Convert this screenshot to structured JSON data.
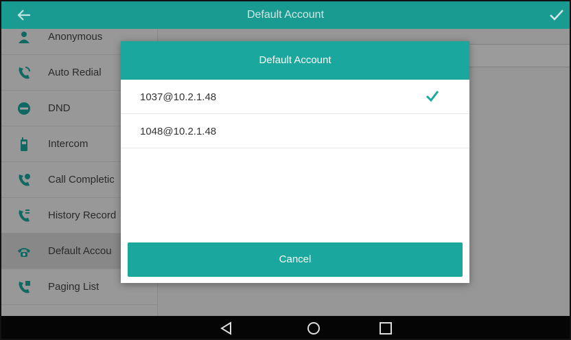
{
  "titlebar": {
    "title": "Default Account",
    "back_icon": "back-arrow-icon",
    "confirm_icon": "checkmark-icon",
    "color": "#1a9b92"
  },
  "sidebar": {
    "items": [
      {
        "label": "Anonymous",
        "icon": "anonymous-icon"
      },
      {
        "label": "Auto Redial",
        "icon": "phone-redial-icon"
      },
      {
        "label": "DND",
        "icon": "dnd-icon"
      },
      {
        "label": "Intercom",
        "icon": "intercom-icon"
      },
      {
        "label": "Call Completic",
        "icon": "call-completion-icon"
      },
      {
        "label": "History Record",
        "icon": "history-record-icon"
      },
      {
        "label": "Default Accou",
        "icon": "default-account-icon"
      },
      {
        "label": "Paging List",
        "icon": "paging-list-icon"
      }
    ]
  },
  "dialog": {
    "title": "Default Account",
    "options": [
      {
        "label": "1037@10.2.1.48",
        "selected": true
      },
      {
        "label": "1048@10.2.1.48",
        "selected": false
      }
    ],
    "cancel_label": "Cancel",
    "accent": "#1aa89e"
  },
  "navbar": {
    "icons": [
      "nav-back-icon",
      "nav-home-icon",
      "nav-recents-icon"
    ]
  }
}
